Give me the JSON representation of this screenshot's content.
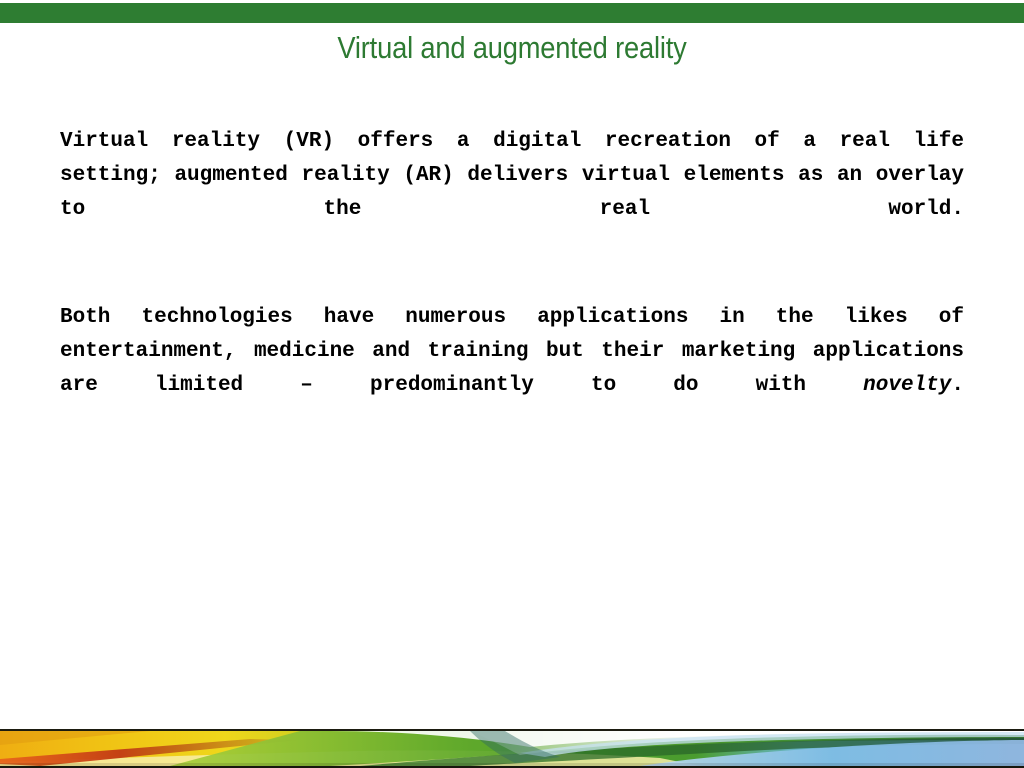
{
  "slide": {
    "title": "Virtual and augmented reality",
    "title_color": "#2D7A32",
    "top_bar_color": "#2E7D32",
    "background_color": "#FFFFFF"
  },
  "body": {
    "paragraphs": [
      {
        "id": "paragraph-1",
        "text": "Virtual reality (VR) offers a digital recreation of a real life setting; augmented reality (AR) delivers virtual elements as an overlay to the real world."
      },
      {
        "id": "paragraph-2",
        "lead": "Both technologies have numerous applications in the likes of entertainment, medicine and training but their marketing applications are limited – predominantly to do with ",
        "emphasis": "novelty",
        "tail": "."
      }
    ]
  },
  "footer_banner": {
    "description": "decorative gradient swoosh band",
    "colors": {
      "orange": "#E8A21C",
      "yellow": "#F2D21A",
      "red_streak": "#C8401A",
      "green": "#4FA12A",
      "dark_green": "#2E6E23",
      "light_green": "#A8D24B",
      "blue": "#5BAEDC",
      "steel_blue": "#7FA8D4",
      "white": "#FFFFFF",
      "edge": "#1B1B10"
    }
  }
}
